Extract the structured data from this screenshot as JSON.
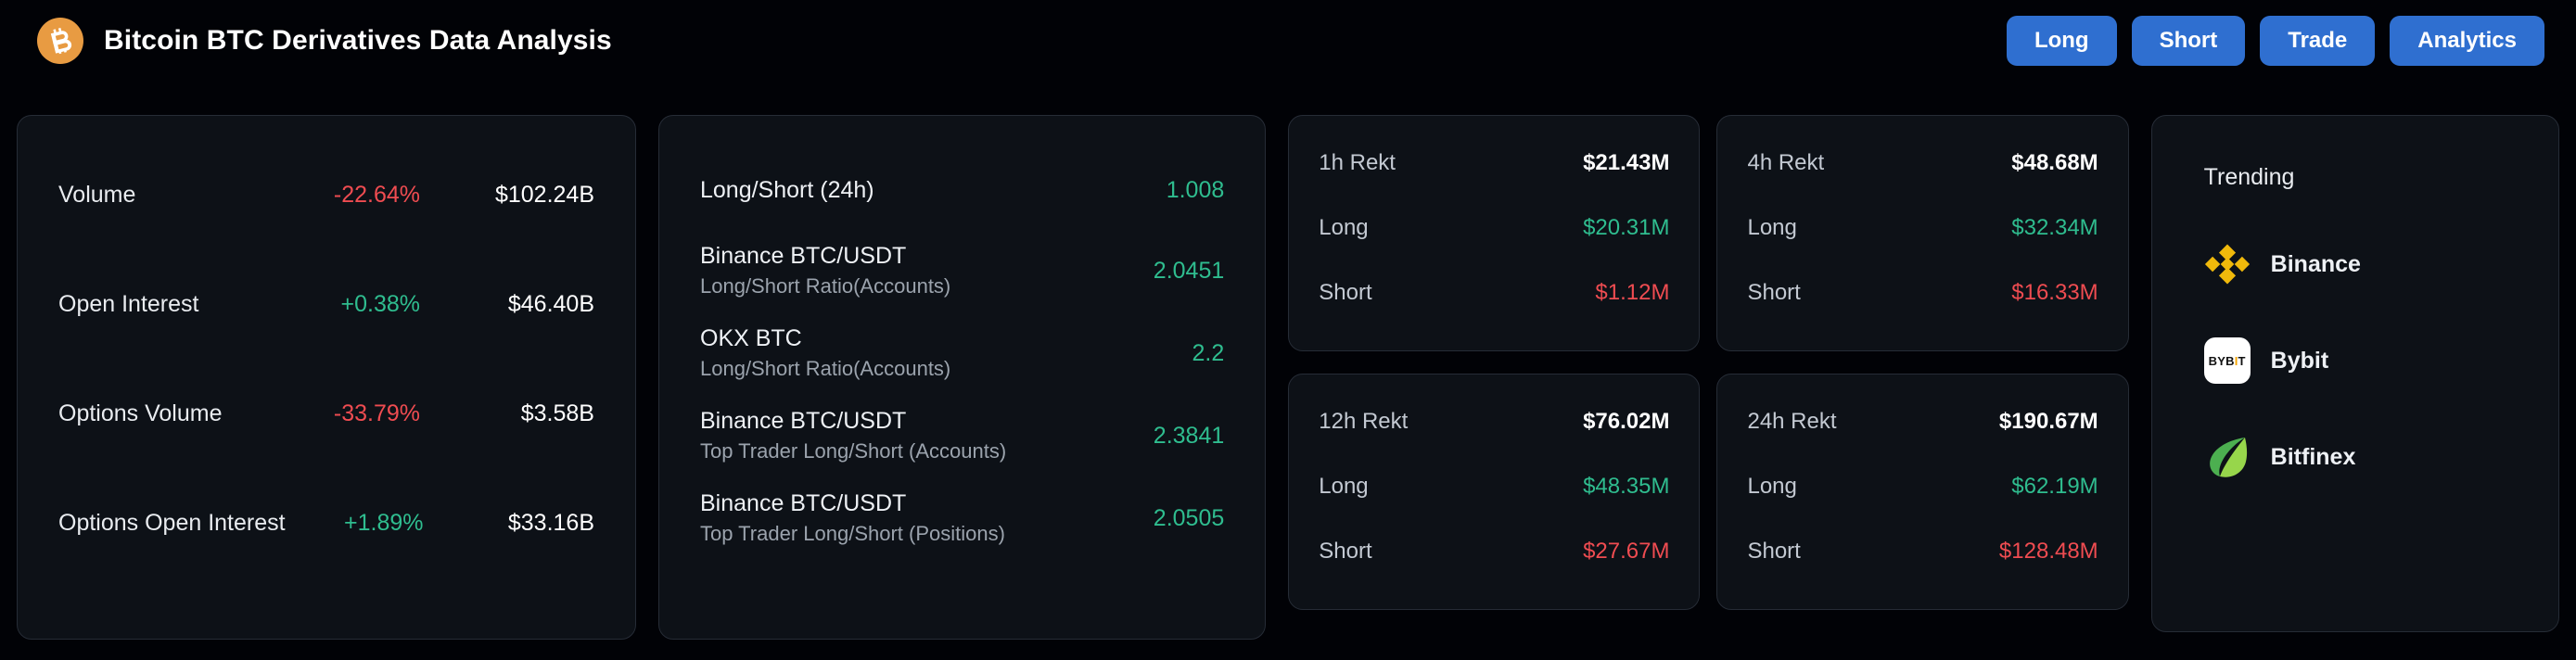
{
  "header": {
    "logo_icon": "bitcoin-icon",
    "title": "Bitcoin BTC Derivatives Data Analysis",
    "accent_color": "#2f6fd0",
    "logo_color": "#e89b42",
    "buttons": [
      {
        "label": "Long"
      },
      {
        "label": "Short"
      },
      {
        "label": "Trade"
      },
      {
        "label": "Analytics"
      }
    ]
  },
  "colors": {
    "up": "#2fbd8f",
    "down": "#ef4c51",
    "card_bg": "#0d1117",
    "page_bg": "#010206"
  },
  "metrics": {
    "rows": [
      {
        "label": "Volume",
        "change": "-22.64%",
        "direction": "down",
        "value": "$102.24B"
      },
      {
        "label": "Open Interest",
        "change": "+0.38%",
        "direction": "up",
        "value": "$46.40B"
      },
      {
        "label": "Options Volume",
        "change": "-33.79%",
        "direction": "down",
        "value": "$3.58B"
      },
      {
        "label": "Options Open Interest",
        "change": "+1.89%",
        "direction": "up",
        "value": "$33.16B"
      }
    ]
  },
  "ratios": {
    "rows": [
      {
        "title": "Long/Short (24h)",
        "sub": "",
        "value": "1.008"
      },
      {
        "title": "Binance BTC/USDT",
        "sub": "Long/Short Ratio(Accounts)",
        "value": "2.0451"
      },
      {
        "title": "OKX BTC",
        "sub": "Long/Short Ratio(Accounts)",
        "value": "2.2"
      },
      {
        "title": "Binance BTC/USDT",
        "sub": "Top Trader Long/Short (Accounts)",
        "value": "2.3841"
      },
      {
        "title": "Binance BTC/USDT",
        "sub": "Top Trader Long/Short (Positions)",
        "value": "2.0505"
      }
    ]
  },
  "rekt": {
    "long_label": "Long",
    "short_label": "Short",
    "cards": [
      {
        "period": "1h Rekt",
        "total": "$21.43M",
        "long": "$20.31M",
        "short": "$1.12M"
      },
      {
        "period": "4h Rekt",
        "total": "$48.68M",
        "long": "$32.34M",
        "short": "$16.33M"
      },
      {
        "period": "12h Rekt",
        "total": "$76.02M",
        "long": "$48.35M",
        "short": "$27.67M"
      },
      {
        "period": "24h Rekt",
        "total": "$190.67M",
        "long": "$62.19M",
        "short": "$128.48M"
      }
    ]
  },
  "trending": {
    "title": "Trending",
    "items": [
      {
        "name": "Binance",
        "icon": "binance-logo-icon",
        "color": "#f0b90b"
      },
      {
        "name": "Bybit",
        "icon": "bybit-logo-icon",
        "color": "#f7a600"
      },
      {
        "name": "Bitfinex",
        "icon": "bitfinex-logo-icon",
        "color": "#4caf50"
      }
    ]
  }
}
